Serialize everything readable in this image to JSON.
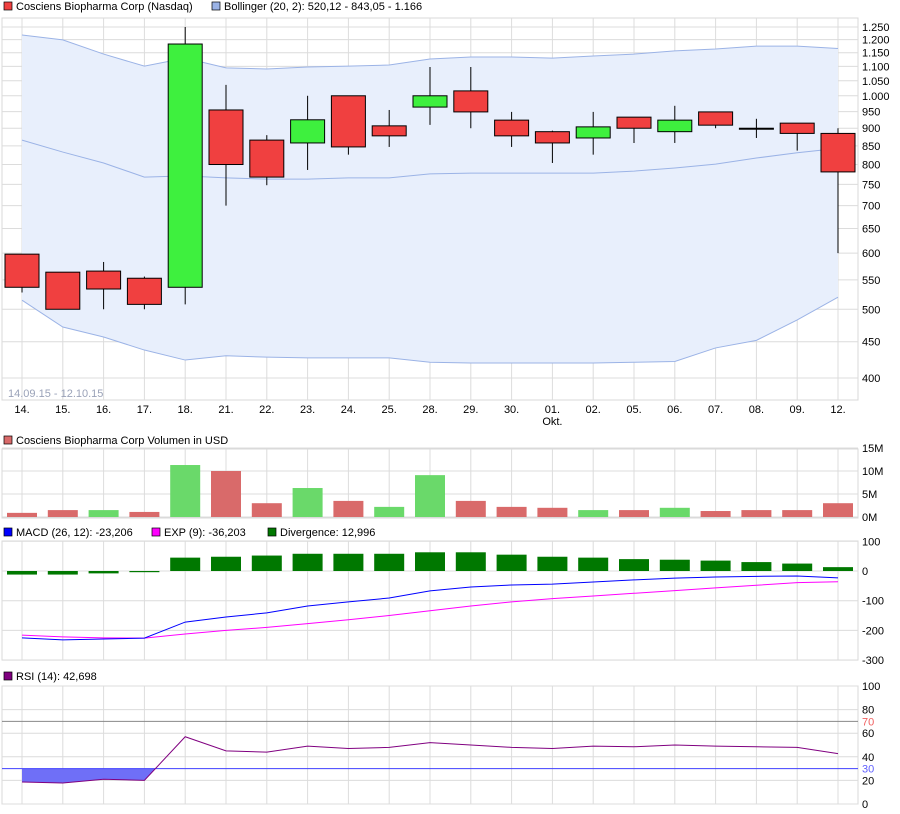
{
  "legend": {
    "price": "Cosciens Biopharma Corp (Nasdaq)",
    "bollinger": "Bollinger (20, 2): 520,12 - 843,05 - 1.166",
    "volume": "Cosciens Biopharma Corp Volumen in USD",
    "macd": "MACD (26, 12): -23,206",
    "exp": "EXP (9): -36,203",
    "divergence": "Divergence: 12,996",
    "rsi": "RSI (14): 42,698"
  },
  "date_range": "14.09.15 - 12.10.15",
  "colors": {
    "up": "#3ef03e",
    "down": "#f04040",
    "vol_up": "#6ad96a",
    "vol_down": "#d96a6a",
    "band": "#e8effc",
    "band_line": "#9bb3e6",
    "macd": "#0000ff",
    "exp": "#ff00ff",
    "div": "#007800",
    "rsi": "#800080"
  },
  "chart_data": [
    {
      "type": "candlestick",
      "title": "Cosciens Biopharma Corp (Nasdaq)",
      "scale": "log",
      "ylim": [
        370,
        1280
      ],
      "x": [
        "14.",
        "15.",
        "16.",
        "17.",
        "18.",
        "21.",
        "22.",
        "23.",
        "24.",
        "25.",
        "28.",
        "29.",
        "30.",
        "01.",
        "02.",
        "05.",
        "06.",
        "07.",
        "08.",
        "09.",
        "12."
      ],
      "month_label": {
        "at": "01.",
        "text": "Okt."
      },
      "yticks": [
        "1.250",
        "1.200",
        "1.150",
        "1.100",
        "1.050",
        "1.000",
        "950",
        "900",
        "850",
        "800",
        "750",
        "700",
        "650",
        "600",
        "550",
        "500",
        "450",
        "400"
      ],
      "ytick_values": [
        1250,
        1200,
        1150,
        1100,
        1050,
        1000,
        950,
        900,
        850,
        800,
        750,
        700,
        650,
        600,
        550,
        500,
        450,
        400
      ],
      "open": [
        598,
        564,
        566,
        553,
        537,
        955,
        866,
        858,
        1000,
        907,
        964,
        1016,
        924,
        890,
        872,
        933,
        890,
        949,
        900,
        915,
        885
      ],
      "high": [
        598,
        564,
        583,
        556,
        1250,
        1036,
        880,
        1000,
        1000,
        955,
        1098,
        1098,
        949,
        893,
        949,
        933,
        968,
        949,
        928,
        915,
        900
      ],
      "low": [
        528,
        500,
        500,
        500,
        508,
        700,
        748,
        786,
        826,
        847,
        910,
        900,
        847,
        804,
        826,
        858,
        858,
        900,
        872,
        837,
        600
      ],
      "close": [
        537,
        500,
        534,
        508,
        1183,
        800,
        768,
        925,
        847,
        878,
        1000,
        949,
        878,
        858,
        904,
        900,
        924,
        909,
        900,
        885,
        781
      ],
      "bollinger": {
        "upper": [
          1218,
          1199,
          1145,
          1101,
          1130,
          1095,
          1091,
          1098,
          1101,
          1105,
          1127,
          1134,
          1134,
          1130,
          1138,
          1145,
          1157,
          1164,
          1175,
          1175,
          1166
        ],
        "middle": [
          866,
          833,
          804,
          768,
          771,
          766,
          763,
          763,
          766,
          766,
          776,
          778,
          778,
          778,
          778,
          783,
          791,
          801,
          817,
          831,
          843
        ],
        "lower": [
          515,
          472,
          457,
          438,
          424,
          430,
          428,
          427,
          427,
          427,
          421,
          420,
          420,
          420,
          420,
          421,
          422,
          441,
          452,
          483,
          520
        ]
      }
    },
    {
      "type": "bar",
      "title": "Cosciens Biopharma Corp Volumen in USD",
      "ylim": [
        0,
        15
      ],
      "yticks": [
        "15M",
        "10M",
        "5M",
        "0M"
      ],
      "ytick_values": [
        15,
        10,
        5,
        0
      ],
      "values": [
        0.9,
        1.5,
        1.5,
        1.1,
        11.3,
        10,
        3,
        6.3,
        3.5,
        2.2,
        9.1,
        3.5,
        2.2,
        2.0,
        1.5,
        1.5,
        2.0,
        1.3,
        1.5,
        1.5,
        3.0
      ],
      "up": [
        false,
        false,
        true,
        false,
        true,
        false,
        false,
        true,
        false,
        true,
        true,
        false,
        false,
        false,
        true,
        false,
        true,
        false,
        false,
        false,
        false
      ]
    },
    {
      "type": "line",
      "title": "MACD",
      "ylim": [
        -300,
        100
      ],
      "yticks": [
        "100",
        "0",
        "-100",
        "-200",
        "-300"
      ],
      "ytick_values": [
        100,
        0,
        -100,
        -200,
        -300
      ],
      "macd": [
        -225,
        -232,
        -229,
        -226,
        -172,
        -155,
        -141,
        -118,
        -104,
        -91,
        -67,
        -54,
        -47,
        -44,
        -37,
        -30,
        -24,
        -20,
        -18,
        -17,
        -23
      ],
      "exp": [
        -216,
        -222,
        -225,
        -226,
        -212,
        -200,
        -190,
        -177,
        -164,
        -150,
        -134,
        -118,
        -104,
        -93,
        -84,
        -75,
        -66,
        -57,
        -48,
        -39,
        -36
      ],
      "divergence": [
        -12,
        -12,
        -8,
        -4,
        45,
        48,
        52,
        58,
        58,
        58,
        63,
        63,
        55,
        48,
        45,
        40,
        38,
        35,
        30,
        25,
        13
      ]
    },
    {
      "type": "line",
      "title": "RSI (14)",
      "ylim": [
        0,
        100
      ],
      "yticks": [
        "100",
        "80",
        "60",
        "40",
        "20",
        "0"
      ],
      "ytick_values": [
        100,
        80,
        60,
        40,
        20,
        0
      ],
      "levels": [
        {
          "value": 70,
          "label": "70"
        },
        {
          "value": 30,
          "label": "30"
        }
      ],
      "values": [
        18.6,
        17.8,
        21,
        20,
        57,
        45,
        44,
        49,
        47,
        48,
        52,
        50,
        48,
        47,
        49,
        48.5,
        50,
        49,
        48.5,
        48,
        42.7
      ]
    }
  ]
}
